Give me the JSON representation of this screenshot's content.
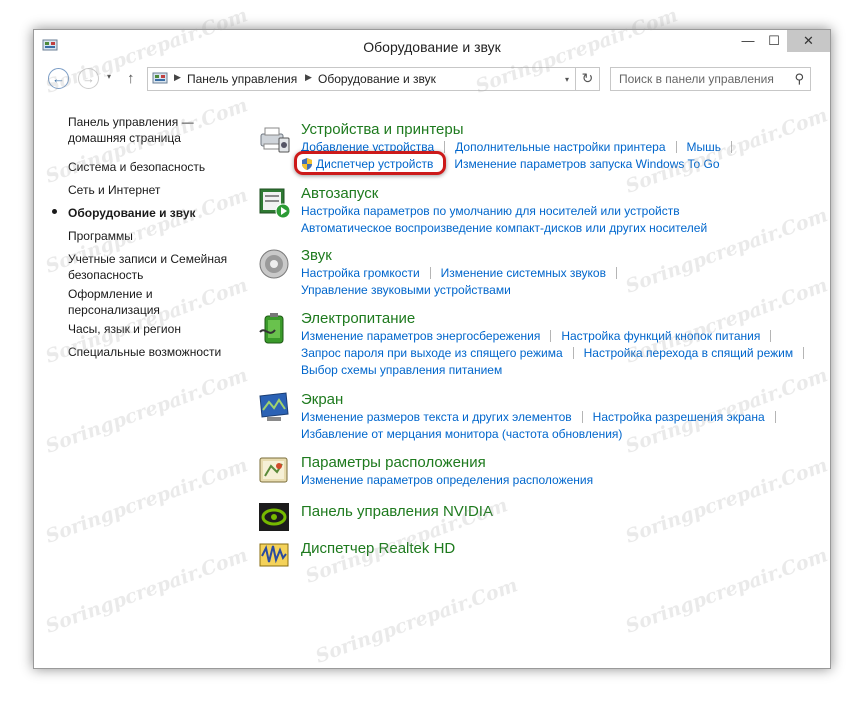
{
  "window": {
    "title": "Оборудование и звук",
    "controls": {
      "minimize": "—",
      "maximize": "☐",
      "close": "✕"
    }
  },
  "navigation": {
    "back": "←",
    "forward": "→",
    "recent": "▾",
    "up": "↑",
    "breadcrumb": [
      "Панель управления",
      "Оборудование и звук"
    ],
    "refresh": "↻",
    "search_placeholder": "Поиск в панели управления"
  },
  "sidebar": {
    "items": [
      {
        "label": "Панель управления — домашняя страница",
        "active": false
      },
      {
        "label": "Система и безопасность",
        "active": false
      },
      {
        "label": "Сеть и Интернет",
        "active": false
      },
      {
        "label": "Оборудование и звук",
        "active": true
      },
      {
        "label": "Программы",
        "active": false
      },
      {
        "label": "Учетные записи и Семейная безопасность",
        "active": false
      },
      {
        "label": "Оформление и персонализация",
        "active": false
      },
      {
        "label": "Часы, язык и регион",
        "active": false
      },
      {
        "label": "Специальные возможности",
        "active": false
      }
    ]
  },
  "categories": [
    {
      "title": "Устройства и принтеры",
      "icon": "devices-printers-icon",
      "links": [
        [
          "Добавление устройства",
          "Дополнительные настройки принтера",
          "Мышь"
        ],
        [
          "Диспетчер устройств",
          "Изменение параметров запуска Windows To Go"
        ]
      ]
    },
    {
      "title": "Автозапуск",
      "icon": "autoplay-icon",
      "links": [
        [
          "Настройка параметров по умолчанию для носителей или устройств"
        ],
        [
          "Автоматическое воспроизведение компакт-дисков или других носителей"
        ]
      ]
    },
    {
      "title": "Звук",
      "icon": "speaker-icon",
      "links": [
        [
          "Настройка громкости",
          "Изменение системных звуков"
        ],
        [
          "Управление звуковыми устройствами"
        ]
      ]
    },
    {
      "title": "Электропитание",
      "icon": "battery-icon",
      "links": [
        [
          "Изменение параметров энергосбережения",
          "Настройка функций кнопок питания"
        ],
        [
          "Запрос пароля при выходе из спящего режима",
          "Настройка перехода в спящий режим"
        ],
        [
          "Выбор схемы управления питанием"
        ]
      ]
    },
    {
      "title": "Экран",
      "icon": "display-icon",
      "links": [
        [
          "Изменение размеров текста и других элементов",
          "Настройка разрешения экрана"
        ],
        [
          "Избавление от мерцания монитора (частота обновления)"
        ]
      ]
    },
    {
      "title": "Параметры расположения",
      "icon": "location-icon",
      "links": [
        [
          "Изменение параметров определения расположения"
        ]
      ]
    },
    {
      "title": "Панель управления NVIDIA",
      "icon": "nvidia-icon",
      "links": []
    },
    {
      "title": "Диспетчер Realtek HD",
      "icon": "realtek-icon",
      "links": []
    }
  ],
  "watermark": "Soringpcrepair.Com",
  "colors": {
    "category_title": "#1e7a1e",
    "link": "#0066cc",
    "highlight": "#cc1a1a"
  }
}
